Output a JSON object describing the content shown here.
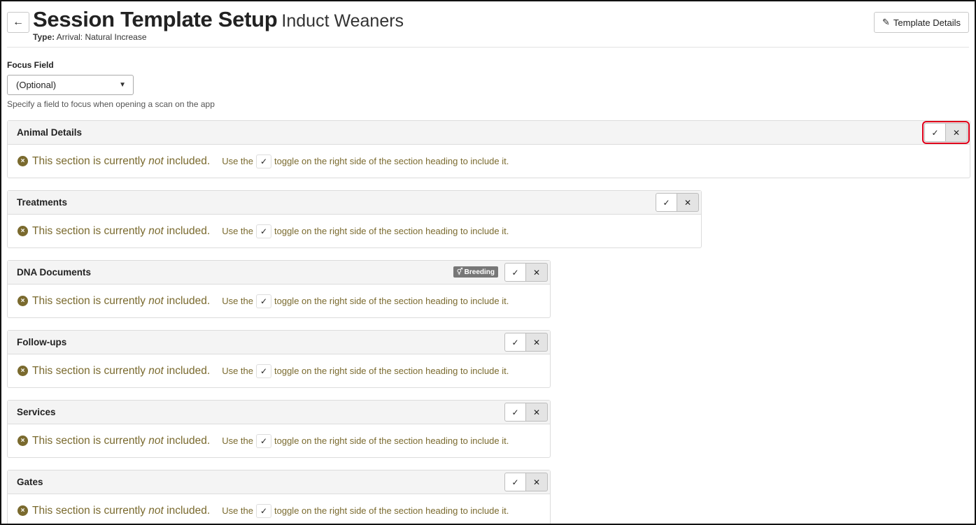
{
  "header": {
    "back_icon": "←",
    "title": "Session Template Setup",
    "subtitle": "Induct Weaners",
    "type_label": "Type:",
    "type_value": "Arrival: Natural Increase",
    "details_icon": "✎",
    "details_button": "Template Details"
  },
  "focus": {
    "label": "Focus Field",
    "selected": "(Optional)",
    "help": "Specify a field to focus when opening a scan on the app"
  },
  "notice": {
    "prefix": "This section is currently",
    "emphasis": "not",
    "suffix": "included.",
    "hint_before": "Use the",
    "hint_after": "toggle on the right side of the section heading to include it.",
    "x_glyph": "×",
    "check_glyph": "✓"
  },
  "toggle": {
    "check_glyph": "✓",
    "close_glyph": "✕"
  },
  "sections": [
    {
      "title": "Animal Details"
    },
    {
      "title": "Treatments"
    },
    {
      "title": "DNA Documents",
      "badge": "Breeding",
      "badge_icon": "⚥"
    },
    {
      "title": "Follow-ups"
    },
    {
      "title": "Services"
    },
    {
      "title": "Gates"
    }
  ],
  "colors": {
    "notice": "#7a6a2e",
    "highlight": "#e0001a",
    "badge": "#777777"
  }
}
